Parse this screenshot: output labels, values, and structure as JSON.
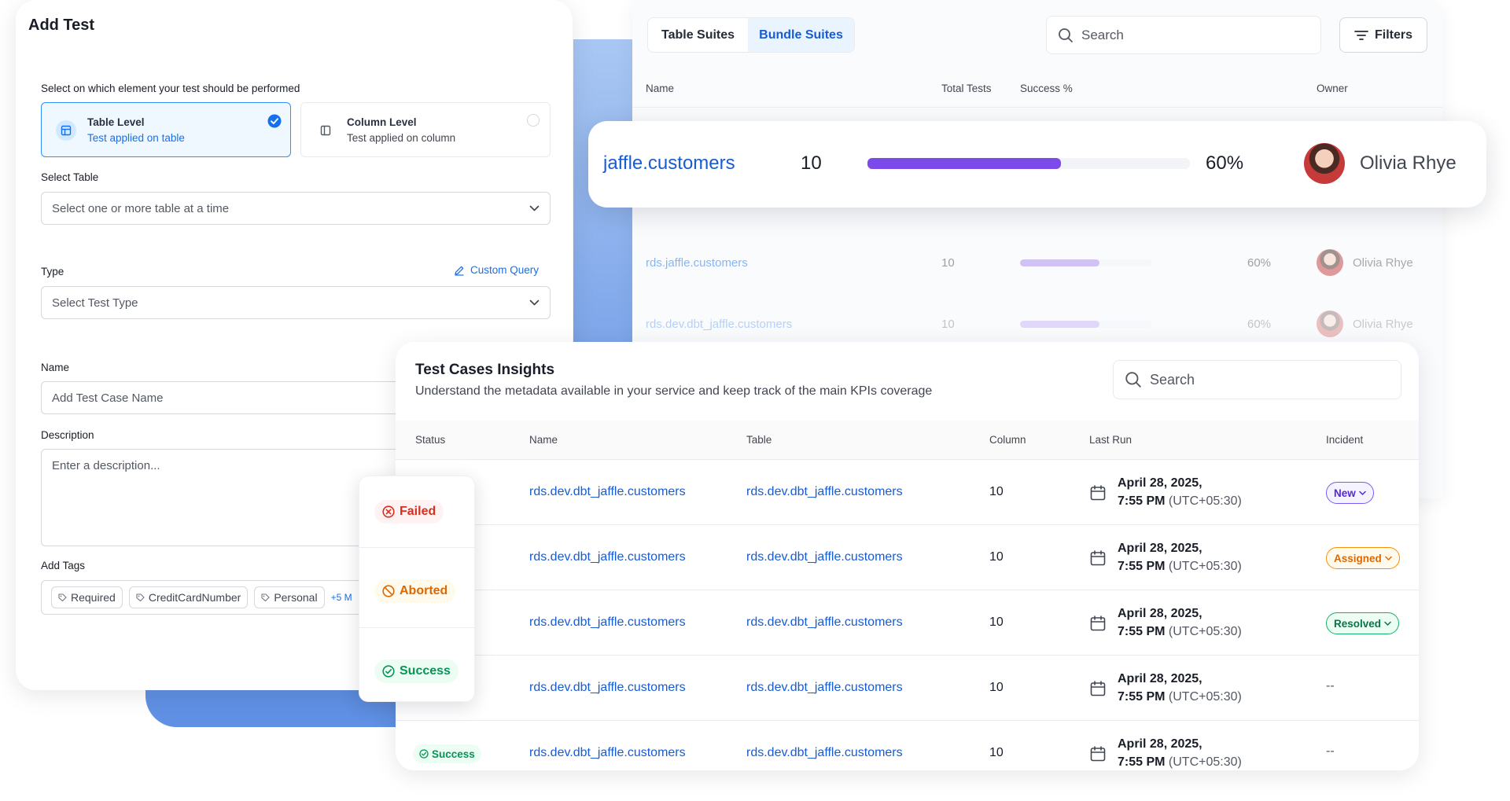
{
  "add_test": {
    "title": "Add Test",
    "element_prompt": "Select on which element your test should be performed",
    "levels": [
      {
        "title": "Table Level",
        "subtitle": "Test applied on table",
        "selected": true,
        "icon": "table-icon"
      },
      {
        "title": "Column Level",
        "subtitle": "Test applied on column",
        "selected": false,
        "icon": "column-icon"
      }
    ],
    "select_table": {
      "label": "Select Table",
      "placeholder": "Select one or more table at a time"
    },
    "type": {
      "label": "Type",
      "custom_query": "Custom Query",
      "placeholder": "Select Test Type"
    },
    "name": {
      "label": "Name",
      "placeholder": "Add Test Case Name"
    },
    "description": {
      "label": "Description",
      "placeholder": "Enter a description..."
    },
    "tags": {
      "label": "Add Tags",
      "items": [
        "Required",
        "CreditCardNumber",
        "Personal"
      ],
      "more": "+5 M"
    }
  },
  "status_menu": {
    "failed": "Failed",
    "aborted": "Aborted",
    "success": "Success"
  },
  "suites": {
    "tabs": [
      "Table Suites",
      "Bundle Suites"
    ],
    "active_tab": "Bundle Suites",
    "search_placeholder": "Search",
    "filters_label": "Filters",
    "columns": {
      "name": "Name",
      "total": "Total Tests",
      "success": "Success %",
      "owner": "Owner"
    },
    "rows": [
      {
        "name": "jaffle.customers",
        "total": "10",
        "success": "60%",
        "success_value": 0.6,
        "owner": "Olivia Rhye"
      },
      {
        "name": "rds.jaffle.customers",
        "total": "10",
        "success": "60%",
        "success_value": 0.6,
        "owner": "Olivia Rhye"
      },
      {
        "name": "rds.dev.dbt_jaffle.customers",
        "total": "10",
        "success": "60%",
        "success_value": 0.6,
        "owner": "Olivia Rhye"
      }
    ]
  },
  "insights": {
    "title": "Test Cases Insights",
    "subtitle": "Understand the metadata available in your service and keep track of the main KPIs coverage",
    "search_placeholder": "Search",
    "columns": {
      "status": "Status",
      "name": "Name",
      "table": "Table",
      "column": "Column",
      "last_run": "Last Run",
      "incident": "Incident"
    },
    "rows": [
      {
        "name": "rds.dev.dbt_jaffle.customers",
        "table": "rds.dev.dbt_jaffle.customers",
        "column": "10",
        "date": "April 28, 2025,",
        "time": "7:55 PM",
        "tz": "(UTC+05:30)",
        "incident": "New"
      },
      {
        "name": "rds.dev.dbt_jaffle.customers",
        "table": "rds.dev.dbt_jaffle.customers",
        "column": "10",
        "date": "April 28, 2025,",
        "time": "7:55 PM",
        "tz": "(UTC+05:30)",
        "incident": "Assigned"
      },
      {
        "name": "rds.dev.dbt_jaffle.customers",
        "table": "rds.dev.dbt_jaffle.customers",
        "column": "10",
        "date": "April 28, 2025,",
        "time": "7:55 PM",
        "tz": "(UTC+05:30)",
        "incident": "Resolved"
      },
      {
        "name": "rds.dev.dbt_jaffle.customers",
        "table": "rds.dev.dbt_jaffle.customers",
        "column": "10",
        "date": "April 28, 2025,",
        "time": "7:55 PM",
        "tz": "(UTC+05:30)",
        "incident": "--"
      },
      {
        "status": "Success",
        "name": "rds.dev.dbt_jaffle.customers",
        "table": "rds.dev.dbt_jaffle.customers",
        "column": "10",
        "date": "April 28, 2025,",
        "time": "7:55 PM",
        "tz": "(UTC+05:30)",
        "incident": "--"
      }
    ]
  },
  "colors": {
    "accent": "#1570ef",
    "progress": "#7b4ae8",
    "failed": "#d92d20",
    "aborted": "#dc6803",
    "success": "#079455"
  }
}
